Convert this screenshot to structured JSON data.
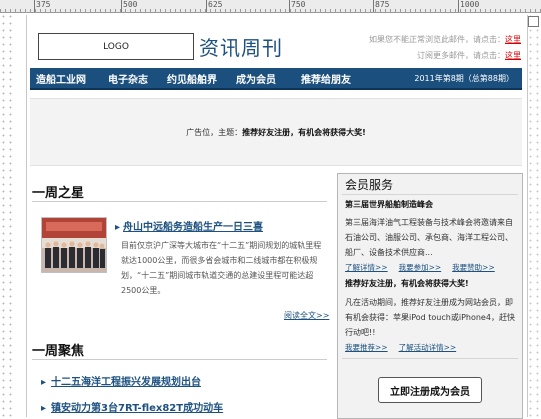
{
  "ruler": {
    "labels": [
      "375",
      "500",
      "625",
      "750",
      "875",
      "1000"
    ]
  },
  "header": {
    "logo": "LOGO",
    "title": "资讯周刊",
    "links": [
      {
        "text": "如果您不能正常浏览此邮件，请点击：",
        "link": "这里"
      },
      {
        "text": "订阅更多邮件，请点击：",
        "link": "这里"
      }
    ]
  },
  "nav": {
    "items": [
      "造船工业网",
      "电子杂志",
      "约见船舶界",
      "成为会员",
      "推荐给朋友"
    ],
    "issue": "2011年第8期（总第88期）"
  },
  "ad": {
    "prefix": "广告位，主题：",
    "text": "推荐好友注册，有机会将获得大奖!"
  },
  "weekly_star": {
    "heading": "一周之星",
    "title": "舟山中远船务造船生产一日三喜",
    "body": "目前仅京沪广深等大城市在“十二五”期间规划的城轨里程就达1000公里，而很多省会城市和二线城市都在积极规划，“十二五”期间城市轨道交通的总建设里程可能达超2500公里。",
    "more": "阅读全文>>"
  },
  "weekly_focus": {
    "heading": "一周聚焦",
    "items": [
      "十二五海洋工程振兴发展规划出台",
      "镇安动力第3台7RT-flex82T成功动车"
    ]
  },
  "member": {
    "heading": "会员服务",
    "event_title": "第三届世界船舶制造峰会",
    "event_text": "第三届海洋油气工程装备与技术峰会将邀请来自石油公司、油服公司、承包商、海洋工程公司、船厂、设备技术供应商...",
    "event_links": [
      "了解详情>>",
      "我要参加>>",
      "我要赞助>>"
    ],
    "promo_title": "推荐好友注册，有机会将获得大奖!",
    "promo_text": "凡在活动期间，推荐好友注册成为网站会员，即有机会获得：苹果iPod touch或iPhone4，赶快行动吧!!",
    "promo_links": [
      "我要推荐>>",
      "了解活动详情>>"
    ],
    "cta": "立即注册成为会员"
  }
}
